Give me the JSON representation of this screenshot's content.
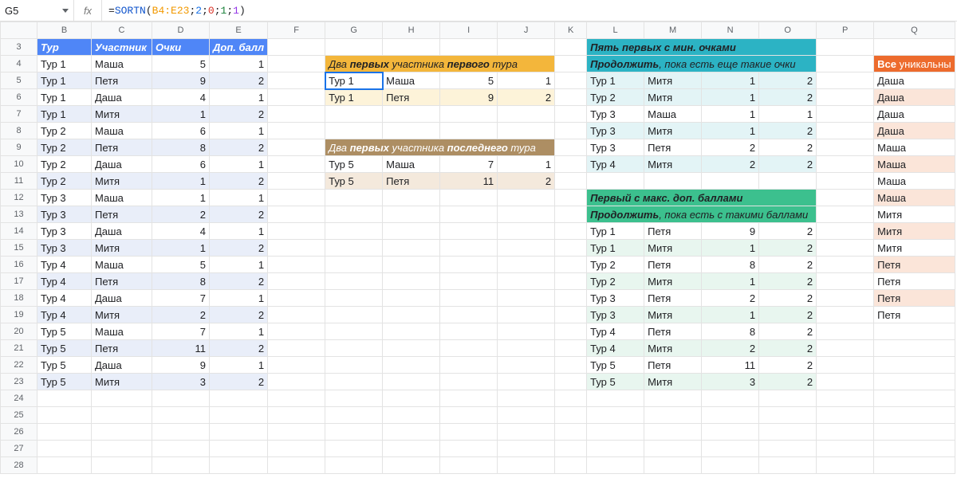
{
  "namebox": "G5",
  "formula_parts": {
    "pre": "=",
    "fn": "SORTN",
    "open": "(",
    "range": "B4:E23",
    "sep1": ";",
    "a": "2",
    "sep2": ";",
    "b": "0",
    "sep3": ";",
    "c": "1",
    "sep4": ";",
    "d": "1",
    "close": ")"
  },
  "cols": [
    "",
    "B",
    "C",
    "D",
    "E",
    "F",
    "G",
    "H",
    "I",
    "J",
    "K",
    "L",
    "M",
    "N",
    "O",
    "P",
    "Q"
  ],
  "rowNums": [
    "3",
    "4",
    "5",
    "6",
    "7",
    "8",
    "9",
    "10",
    "11",
    "12",
    "13",
    "14",
    "15",
    "16",
    "17",
    "18",
    "19",
    "20",
    "21",
    "22",
    "23",
    "24",
    "25",
    "26",
    "27",
    "28"
  ],
  "headers": {
    "tour": "Тур",
    "name": "Участник",
    "pts": "Очки",
    "bonus": "Доп. балл"
  },
  "data": [
    {
      "t": "Тур 1",
      "n": "Маша",
      "p": "5",
      "b": "1"
    },
    {
      "t": "Тур 1",
      "n": "Петя",
      "p": "9",
      "b": "2"
    },
    {
      "t": "Тур 1",
      "n": "Даша",
      "p": "4",
      "b": "1"
    },
    {
      "t": "Тур 1",
      "n": "Митя",
      "p": "1",
      "b": "2"
    },
    {
      "t": "Тур 2",
      "n": "Маша",
      "p": "6",
      "b": "1"
    },
    {
      "t": "Тур 2",
      "n": "Петя",
      "p": "8",
      "b": "2"
    },
    {
      "t": "Тур 2",
      "n": "Даша",
      "p": "6",
      "b": "1"
    },
    {
      "t": "Тур 2",
      "n": "Митя",
      "p": "1",
      "b": "2"
    },
    {
      "t": "Тур 3",
      "n": "Маша",
      "p": "1",
      "b": "1"
    },
    {
      "t": "Тур 3",
      "n": "Петя",
      "p": "2",
      "b": "2"
    },
    {
      "t": "Тур 3",
      "n": "Даша",
      "p": "4",
      "b": "1"
    },
    {
      "t": "Тур 3",
      "n": "Митя",
      "p": "1",
      "b": "2"
    },
    {
      "t": "Тур 4",
      "n": "Маша",
      "p": "5",
      "b": "1"
    },
    {
      "t": "Тур 4",
      "n": "Петя",
      "p": "8",
      "b": "2"
    },
    {
      "t": "Тур 4",
      "n": "Даша",
      "p": "7",
      "b": "1"
    },
    {
      "t": "Тур 4",
      "n": "Митя",
      "p": "2",
      "b": "2"
    },
    {
      "t": "Тур 5",
      "n": "Маша",
      "p": "7",
      "b": "1"
    },
    {
      "t": "Тур 5",
      "n": "Петя",
      "p": "11",
      "b": "2"
    },
    {
      "t": "Тур 5",
      "n": "Даша",
      "p": "9",
      "b": "1"
    },
    {
      "t": "Тур 5",
      "n": "Митя",
      "p": "3",
      "b": "2"
    }
  ],
  "yellow": {
    "title": {
      "a": "Два ",
      "b": "первых",
      "c": " участника ",
      "d": "первого",
      "e": " тура"
    },
    "rows": [
      {
        "t": "Тур 1",
        "n": "Маша",
        "p": "5",
        "b": "1"
      },
      {
        "t": "Тур 1",
        "n": "Петя",
        "p": "9",
        "b": "2"
      }
    ]
  },
  "brown": {
    "title": {
      "a": "Два ",
      "b": "первых",
      "c": " участника ",
      "d": "последнего",
      "e": " тура"
    },
    "rows": [
      {
        "t": "Тур 5",
        "n": "Маша",
        "p": "7",
        "b": "1"
      },
      {
        "t": "Тур 5",
        "n": "Петя",
        "p": "11",
        "b": "2"
      }
    ]
  },
  "teal": {
    "h1": {
      "a": "Пять ",
      "b": "первых",
      "c": " с мин. очками"
    },
    "h2": {
      "a": "Продолжить",
      "b": ", пока есть еще такие очки"
    },
    "rows": [
      {
        "t": "Тур 1",
        "n": "Митя",
        "p": "1",
        "b": "2",
        "c": "tB"
      },
      {
        "t": "Тур 2",
        "n": "Митя",
        "p": "1",
        "b": "2",
        "c": "tB"
      },
      {
        "t": "Тур 3",
        "n": "Маша",
        "p": "1",
        "b": "1",
        "c": ""
      },
      {
        "t": "Тур 3",
        "n": "Митя",
        "p": "1",
        "b": "2",
        "c": "tB"
      },
      {
        "t": "Тур 3",
        "n": "Петя",
        "p": "2",
        "b": "2",
        "c": ""
      },
      {
        "t": "Тур 4",
        "n": "Митя",
        "p": "2",
        "b": "2",
        "c": "tB"
      }
    ]
  },
  "green": {
    "h1": {
      "a": "Первый",
      "b": " с макс. доп. баллами"
    },
    "h2": {
      "a": "Продолжить",
      "b": ", пока есть с такими баллами"
    },
    "rows": [
      {
        "t": "Тур 1",
        "n": "Петя",
        "p": "9",
        "b": "2",
        "c": ""
      },
      {
        "t": "Тур 1",
        "n": "Митя",
        "p": "1",
        "b": "2",
        "c": "gB"
      },
      {
        "t": "Тур 2",
        "n": "Петя",
        "p": "8",
        "b": "2",
        "c": ""
      },
      {
        "t": "Тур 2",
        "n": "Митя",
        "p": "1",
        "b": "2",
        "c": "gB"
      },
      {
        "t": "Тур 3",
        "n": "Петя",
        "p": "2",
        "b": "2",
        "c": ""
      },
      {
        "t": "Тур 3",
        "n": "Митя",
        "p": "1",
        "b": "2",
        "c": "gB"
      },
      {
        "t": "Тур 4",
        "n": "Петя",
        "p": "8",
        "b": "2",
        "c": ""
      },
      {
        "t": "Тур 4",
        "n": "Митя",
        "p": "2",
        "b": "2",
        "c": "gB"
      },
      {
        "t": "Тур 5",
        "n": "Петя",
        "p": "11",
        "b": "2",
        "c": ""
      },
      {
        "t": "Тур 5",
        "n": "Митя",
        "p": "3",
        "b": "2",
        "c": "gB"
      }
    ]
  },
  "orange": {
    "title": {
      "a": "Все",
      "b": " уникальны"
    },
    "rows": [
      "Даша",
      "Даша",
      "Даша",
      "Даша",
      "Маша",
      "Маша",
      "Маша",
      "Маша",
      "Митя",
      "Митя",
      "Митя",
      "Петя",
      "Петя",
      "Петя",
      "Петя"
    ]
  }
}
